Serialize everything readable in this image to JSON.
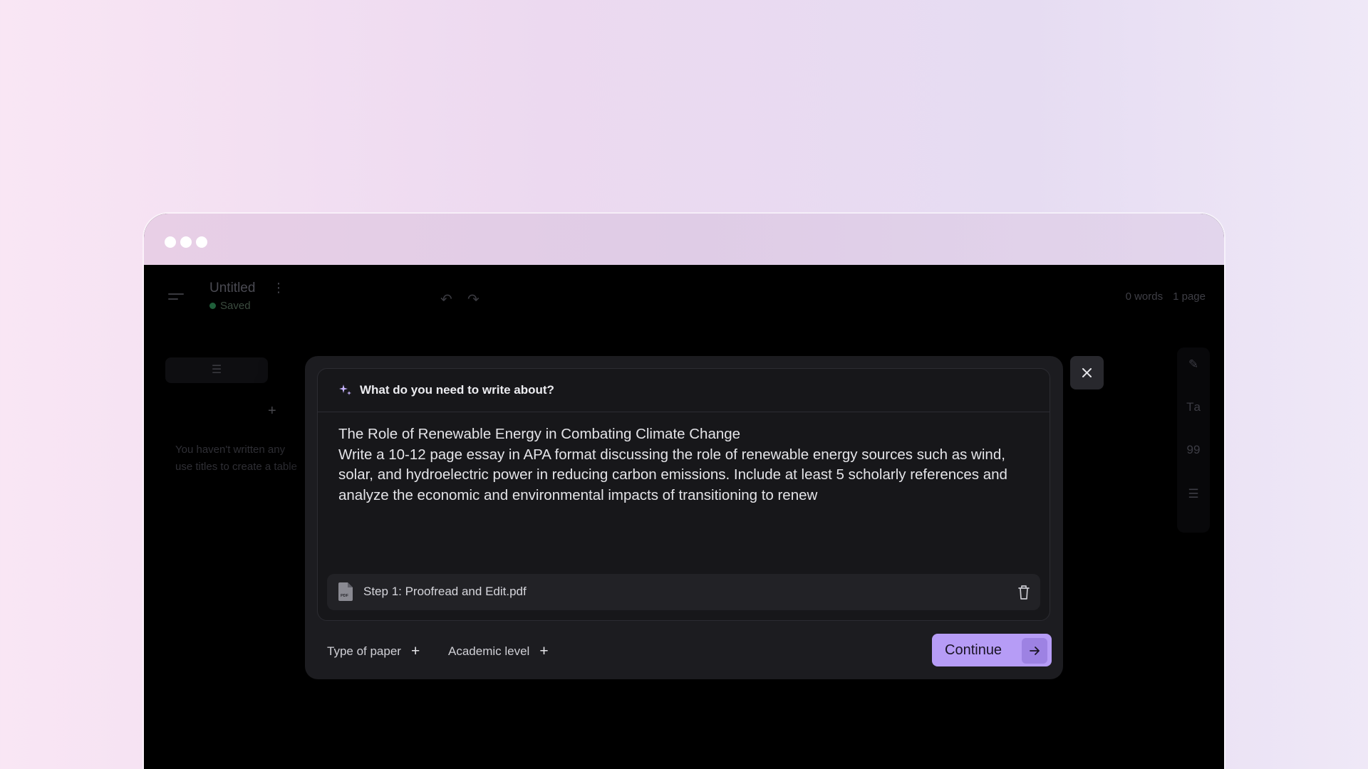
{
  "document": {
    "title": "Untitled",
    "status": "Saved",
    "word_count": "0 words",
    "page_count": "1 page"
  },
  "outline": {
    "empty_text": "You haven't written any\nuse titles to create a table"
  },
  "dialog": {
    "heading": "What do you need to write about?",
    "prompt": "The Role of Renewable Energy in Combating Climate Change\nWrite a 10-12 page essay in APA format discussing the role of renewable energy sources such as wind, solar, and hydroelectric power in reducing carbon emissions. Include at least 5 scholarly references and analyze the economic and environmental impacts of transitioning to renew",
    "attachment": {
      "name": "Step 1: Proofread and Edit.pdf",
      "type_label": "PDF"
    },
    "options": [
      {
        "label": "Type of paper"
      },
      {
        "label": "Academic level"
      }
    ],
    "continue_label": "Continue"
  },
  "icons": {
    "window_controls": "traffic-dots",
    "menu": "menu-icon",
    "undo": "undo-icon",
    "redo": "redo-icon",
    "sparkle": "sparkle-icon",
    "close": "close-icon",
    "trash": "trash-icon",
    "arrow": "arrow-right-icon",
    "rail": [
      "pen-icon",
      "text-format-icon",
      "quote-icon",
      "list-icon"
    ]
  },
  "colors": {
    "accent": "#b69cf6",
    "accent_dark": "#9d82e3",
    "modal_bg": "#1c1c20",
    "app_bg": "#000000"
  }
}
